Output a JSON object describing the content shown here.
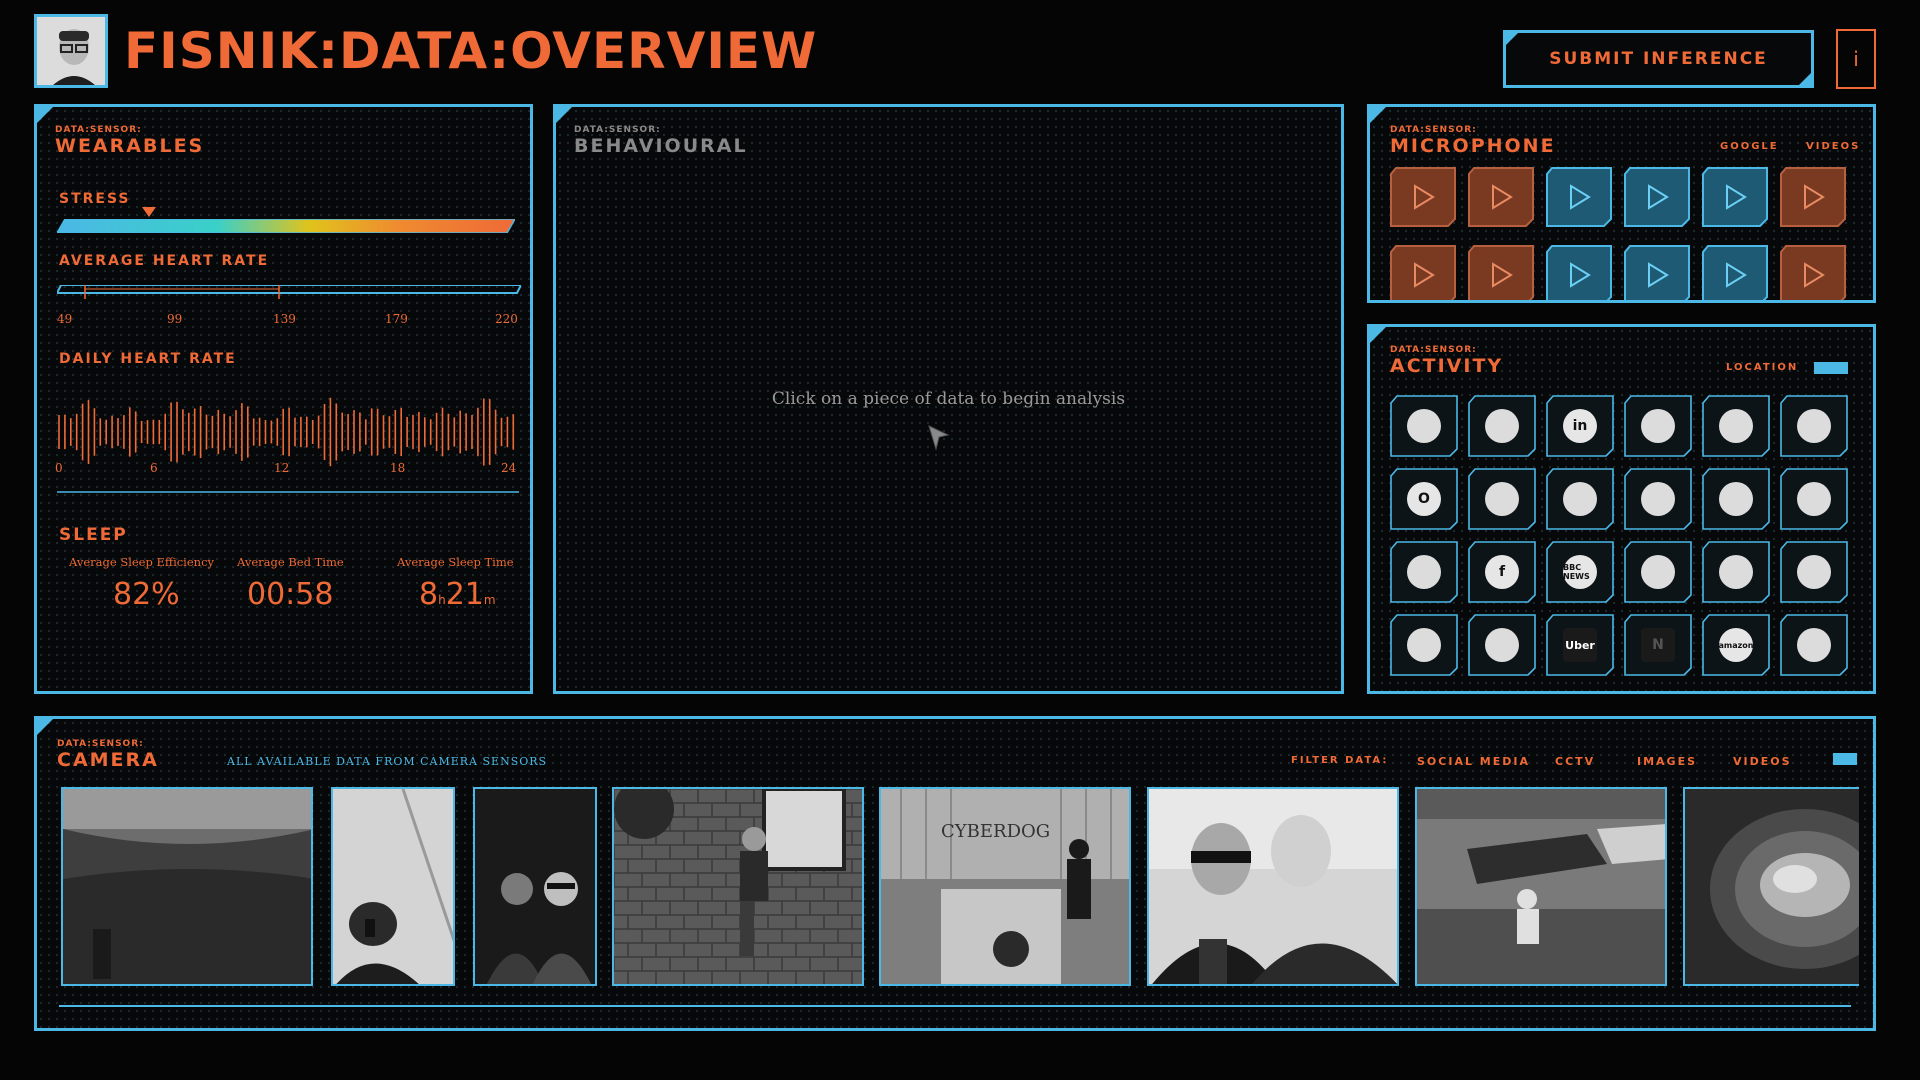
{
  "header": {
    "title": "FISNIK:DATA:OVERVIEW",
    "submit_label": "SUBMIT INFERENCE",
    "info_label": "i"
  },
  "wearables": {
    "prefix": "DATA:SENSOR:",
    "title": "WEARABLES",
    "stress_label": "STRESS",
    "stress_level": 0.2,
    "avg_hr_label": "AVERAGE HEART RATE",
    "hr_ticks": [
      "49",
      "99",
      "139",
      "179",
      "220"
    ],
    "daily_hr_label": "DAILY HEART RATE",
    "daily_ticks": [
      "0",
      "6",
      "12",
      "18",
      "24"
    ],
    "sleep_label": "SLEEP",
    "sleep": {
      "efficiency_label": "Average Sleep Efficiency",
      "efficiency_value": "82%",
      "bed_label": "Average Bed Time",
      "bed_value": "00:58",
      "time_label": "Average Sleep Time",
      "time_hours": "8",
      "time_h_unit": "h",
      "time_minutes": "21",
      "time_m_unit": "m"
    }
  },
  "behavioural": {
    "prefix": "DATA:SENSOR:",
    "title": "BEHAVIOURAL",
    "hint": "Click on a piece of data to begin analysis"
  },
  "microphone": {
    "prefix": "DATA:SENSOR:",
    "title": "MICROPHONE",
    "link_google": "GOOGLE",
    "link_videos": "VIDEOS"
  },
  "activity": {
    "prefix": "DATA:SENSOR:",
    "title": "ACTIVITY",
    "location_label": "LOCATION",
    "apps": [
      "instagram",
      "google-drive",
      "linkedin",
      "google-maps",
      "gmail",
      "forward",
      "outlook",
      "twitter",
      "snapchat",
      "lloyds",
      "tiktok",
      "email",
      "dropbox",
      "facebook",
      "bbc-news",
      "google-photos",
      "home",
      "youtube",
      "slack",
      "spotify",
      "uber",
      "netflix",
      "amazon",
      "whatsapp"
    ],
    "app_texts": {
      "linkedin": "in",
      "bbc-news": "BBC NEWS",
      "uber": "Uber",
      "netflix": "N",
      "amazon": "amazon",
      "facebook": "f",
      "outlook": "O"
    }
  },
  "camera": {
    "prefix": "DATA:SENSOR:",
    "title": "CAMERA",
    "subtitle": "ALL AVAILABLE DATA FROM CAMERA SENSORS",
    "filter_label": "FILTER DATA:",
    "filters": [
      "SOCIAL MEDIA",
      "CCTV",
      "IMAGES",
      "VIDEOS"
    ],
    "photo_texts": {
      "club_sign": "CYBERDOG"
    }
  },
  "colors": {
    "accent_blue": "#4bb8e6",
    "accent_orange": "#ef6a37",
    "background": "#050505",
    "mic_tile_orange": "#7a3a22",
    "mic_tile_blue": "#1e5a74"
  }
}
